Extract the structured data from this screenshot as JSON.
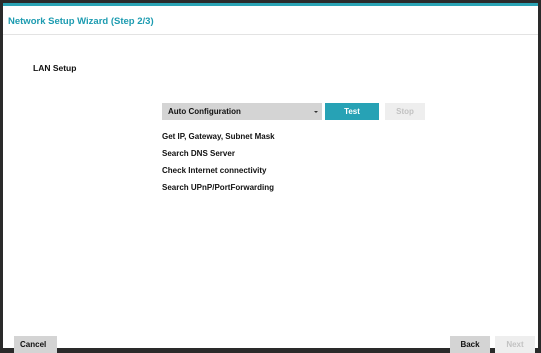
{
  "dialog": {
    "title": "Network Setup Wizard (Step 2/3)",
    "section_label": "LAN Setup"
  },
  "config": {
    "mode_selected": "Auto Configuration",
    "test_label": "Test",
    "stop_label": "Stop"
  },
  "status_steps": [
    "Get IP, Gateway, Subnet Mask",
    "Search DNS Server",
    "Check Internet connectivity",
    "Search UPnP/PortForwarding"
  ],
  "footer": {
    "cancel_label": "Cancel",
    "back_label": "Back",
    "next_label": "Next"
  },
  "colors": {
    "accent": "#27a2b5",
    "button_gray": "#d4d4d4",
    "disabled_bg": "#eeeeee",
    "disabled_text": "#c2c2c2"
  }
}
